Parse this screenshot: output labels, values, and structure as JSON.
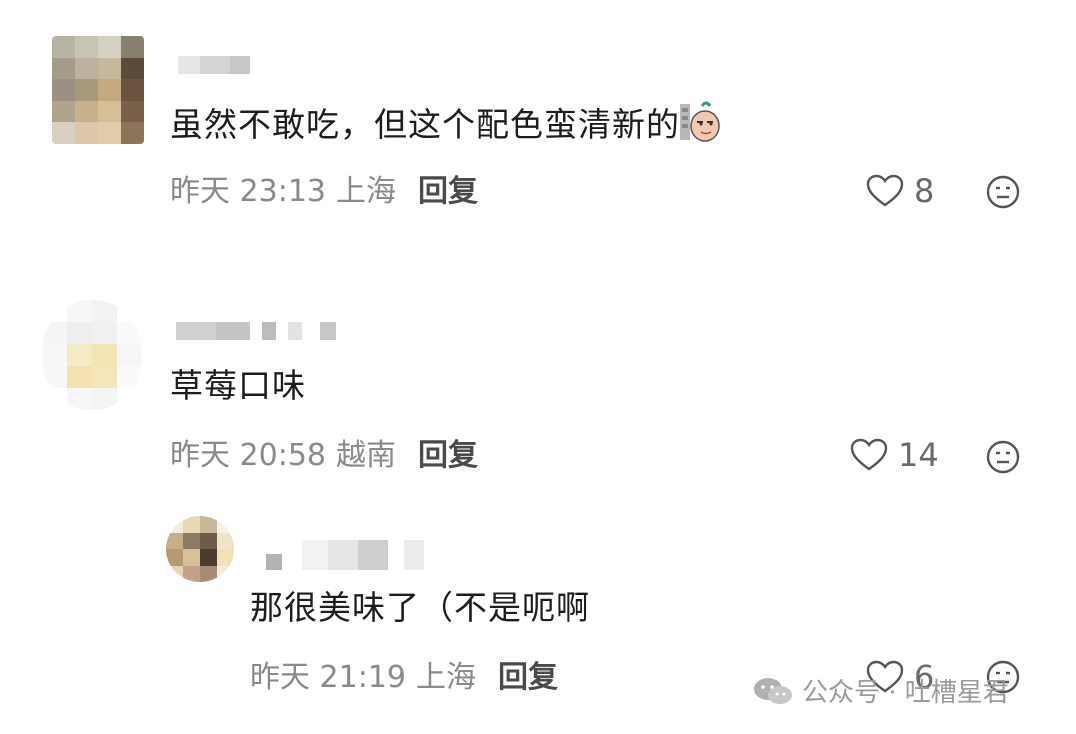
{
  "comments": [
    {
      "text": "虽然不敢吃，但这个配色蛮清新的",
      "sticker": "smirk-potato-sticker",
      "time": "昨天 23:13",
      "location": "上海",
      "reply_label": "回复",
      "likes": "8"
    },
    {
      "text": "草莓口味",
      "time": "昨天 20:58",
      "location": "越南",
      "reply_label": "回复",
      "likes": "14"
    },
    {
      "text": "那很美味了（不是呃啊",
      "time": "昨天 21:19",
      "location": "上海",
      "reply_label": "回复",
      "likes": "6"
    }
  ],
  "watermark": {
    "icon": "wechat-icon",
    "text": "公众号 · 吐槽星君"
  },
  "colors": {
    "meta": "#8a8a8a",
    "text": "#1d1d1d",
    "reply": "#4a4a4a"
  }
}
